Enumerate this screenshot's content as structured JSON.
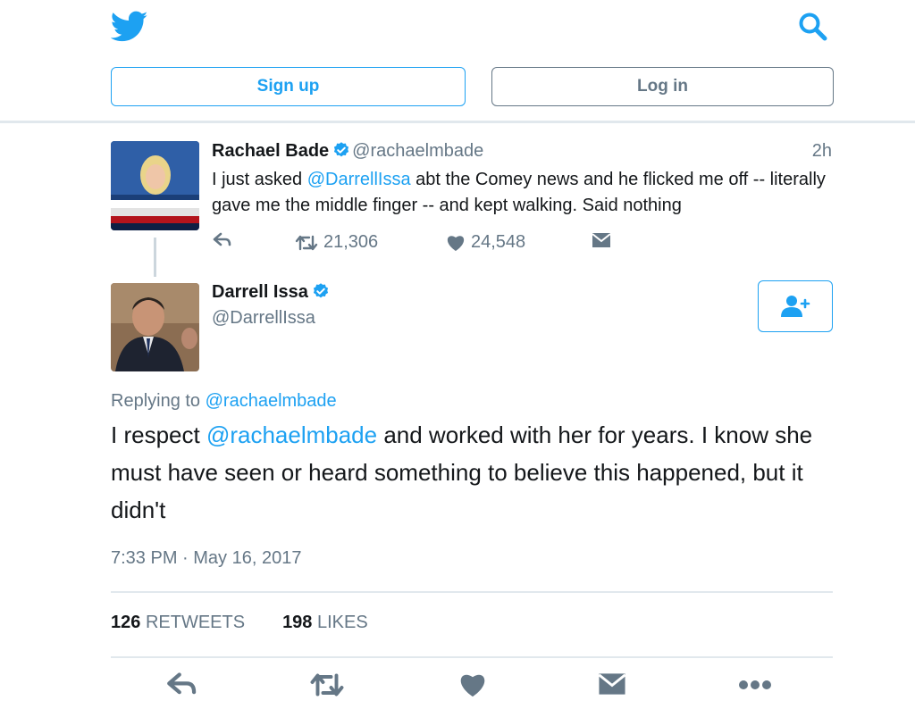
{
  "header": {
    "logo_icon": "twitter-bird-icon",
    "search_icon": "search-icon",
    "signup_label": "Sign up",
    "login_label": "Log in"
  },
  "quoted_tweet": {
    "name": "Rachael Bade",
    "handle": "@rachaelmbade",
    "time": "2h",
    "text_before": "I just asked ",
    "mention": "@DarrellIssa",
    "text_after": " abt the Comey news and he flicked me off -- literally gave me the middle finger -- and kept walking. Said nothing",
    "retweets": "21,306",
    "likes": "24,548"
  },
  "tweet": {
    "name": "Darrell Issa",
    "handle": "@DarrellIssa",
    "replying_prefix": "Replying to ",
    "replying_to": "@rachaelmbade",
    "text_before": "I respect ",
    "mention": "@rachaelmbade",
    "text_after": " and worked with her for years. I know she must have seen or heard something to believe this happened, but it didn't",
    "timestamp": "7:33 PM · May 16, 2017",
    "retweet_count": "126",
    "retweet_label": "RETWEETS",
    "like_count": "198",
    "like_label": "LIKES"
  },
  "colors": {
    "brand_blue": "#1da1f2",
    "secondary_gray": "#657786",
    "rule_gray": "#e1e8ed"
  }
}
